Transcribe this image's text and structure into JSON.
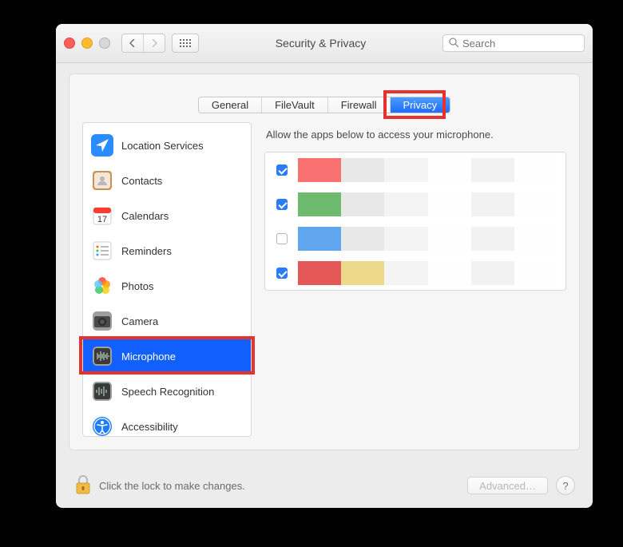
{
  "window": {
    "title": "Security & Privacy"
  },
  "search": {
    "placeholder": "Search"
  },
  "tabs": [
    {
      "label": "General",
      "active": false
    },
    {
      "label": "FileVault",
      "active": false
    },
    {
      "label": "Firewall",
      "active": false
    },
    {
      "label": "Privacy",
      "active": true
    }
  ],
  "sidebar": {
    "items": [
      {
        "label": "Location Services",
        "icon": "location-icon",
        "selected": false
      },
      {
        "label": "Contacts",
        "icon": "contacts-icon",
        "selected": false
      },
      {
        "label": "Calendars",
        "icon": "calendar-icon",
        "selected": false
      },
      {
        "label": "Reminders",
        "icon": "reminders-icon",
        "selected": false
      },
      {
        "label": "Photos",
        "icon": "photos-icon",
        "selected": false
      },
      {
        "label": "Camera",
        "icon": "camera-icon",
        "selected": false
      },
      {
        "label": "Microphone",
        "icon": "microphone-icon",
        "selected": true
      },
      {
        "label": "Speech Recognition",
        "icon": "speech-icon",
        "selected": false
      },
      {
        "label": "Accessibility",
        "icon": "accessibility-icon",
        "selected": false
      }
    ]
  },
  "pane": {
    "hint": "Allow the apps below to access your microphone.",
    "apps": [
      {
        "checked": true,
        "blur": [
          "#f97070",
          "#e8e8e8",
          "#f4f4f4",
          "#fefefe",
          "#f2f2f2",
          "#fefefe"
        ]
      },
      {
        "checked": true,
        "blur": [
          "#6dbb6d",
          "#e8e8e8",
          "#f4f4f4",
          "#fefefe",
          "#f2f2f2",
          "#fefefe"
        ]
      },
      {
        "checked": false,
        "blur": [
          "#5fa6ef",
          "#e8e8e8",
          "#f4f4f4",
          "#fefefe",
          "#f2f2f2",
          "#fefefe"
        ]
      },
      {
        "checked": true,
        "blur": [
          "#e45757",
          "#edd98a",
          "#f4f4f4",
          "#fefefe",
          "#f2f2f2",
          "#fefefe"
        ]
      }
    ]
  },
  "footer": {
    "lock_text": "Click the lock to make changes.",
    "advanced_label": "Advanced…",
    "help_label": "?"
  },
  "highlights": [
    {
      "target": "tab-privacy"
    },
    {
      "target": "sidebar-item-microphone"
    }
  ]
}
